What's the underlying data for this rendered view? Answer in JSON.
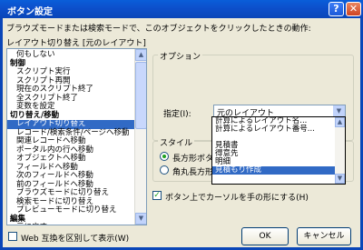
{
  "window": {
    "title": "ボタン設定"
  },
  "titlebar_buttons": {
    "help": "?",
    "close": "✕"
  },
  "instruction": "ブラウズモードまたは検索モードで、このオブジェクトをクリックしたときの動作:",
  "list_label": "レイアウト切り替え [元のレイアウト]",
  "list_items": [
    {
      "label": "何もしない",
      "type": "item"
    },
    {
      "label": "制御",
      "type": "category"
    },
    {
      "label": "スクリプト実行",
      "type": "item"
    },
    {
      "label": "スクリプト再開",
      "type": "item"
    },
    {
      "label": "現在のスクリプト終了",
      "type": "item"
    },
    {
      "label": "全スクリプト終了",
      "type": "item"
    },
    {
      "label": "変数を設定",
      "type": "item"
    },
    {
      "label": "切り替え/移動",
      "type": "category"
    },
    {
      "label": "レイアウト切り替え",
      "type": "item",
      "selected": true
    },
    {
      "label": "レコード/検索条件/ページへ移動",
      "type": "item"
    },
    {
      "label": "関連レコードへ移動",
      "type": "item"
    },
    {
      "label": "ポータル内の行へ移動",
      "type": "item"
    },
    {
      "label": "オブジェクトへ移動",
      "type": "item"
    },
    {
      "label": "フィールドへ移動",
      "type": "item"
    },
    {
      "label": "次のフィールドへ移動",
      "type": "item"
    },
    {
      "label": "前のフィールドへ移動",
      "type": "item"
    },
    {
      "label": "ブラウズモードに切り替え",
      "type": "item"
    },
    {
      "label": "検索モードに切り替え",
      "type": "item"
    },
    {
      "label": "プレビューモードに切り替え",
      "type": "item"
    },
    {
      "label": "編集",
      "type": "category"
    },
    {
      "label": "元に戻す",
      "type": "item"
    }
  ],
  "web_compat": {
    "label": "Web 互換を区別して表示(W)",
    "checked": false
  },
  "option_group": {
    "label": "オプション"
  },
  "spec": {
    "label": "指定(I):",
    "value": "元のレイアウト"
  },
  "dropdown_items": [
    {
      "label": "計算によるレイアウト名..."
    },
    {
      "label": "計算によるレイアウト番号..."
    },
    {
      "label": ""
    },
    {
      "label": "見積書"
    },
    {
      "label": "得意先"
    },
    {
      "label": "明細"
    },
    {
      "label": "見積もり作成",
      "highlight": true
    }
  ],
  "style_group": {
    "label": "スタイル"
  },
  "style_options": [
    {
      "label": "長方形ボタン",
      "selected": true
    },
    {
      "label": "角丸長方形ボタン",
      "selected": false
    }
  ],
  "hand_cursor": {
    "label": "ボタン上でカーソルを手の形にする(H)",
    "checked": true
  },
  "buttons": {
    "ok": "OK",
    "cancel": "キャンセル"
  }
}
